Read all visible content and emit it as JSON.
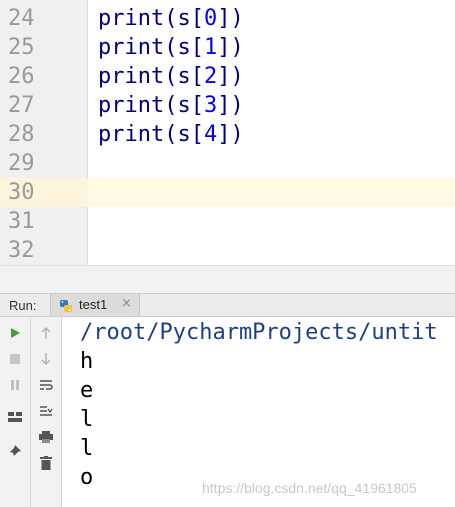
{
  "editor": {
    "lines": [
      {
        "num": "24",
        "pre": "print(s[",
        "idx": "0",
        "post": "])"
      },
      {
        "num": "25",
        "pre": "print(s[",
        "idx": "1",
        "post": "])"
      },
      {
        "num": "26",
        "pre": "print(s[",
        "idx": "2",
        "post": "])"
      },
      {
        "num": "27",
        "pre": "print(s[",
        "idx": "3",
        "post": "])"
      },
      {
        "num": "28",
        "pre": "print(s[",
        "idx": "4",
        "post": "])"
      },
      {
        "num": "29",
        "pre": "",
        "idx": "",
        "post": ""
      },
      {
        "num": "30",
        "pre": "",
        "idx": "",
        "post": ""
      },
      {
        "num": "31",
        "pre": "",
        "idx": "",
        "post": ""
      },
      {
        "num": "32",
        "pre": "",
        "idx": "",
        "post": ""
      }
    ],
    "current_line_index": 6
  },
  "run_panel": {
    "label": "Run:",
    "tab": {
      "label": "test1",
      "close": "×",
      "icon": "python-file-icon"
    },
    "console_lines": [
      "/root/PycharmProjects/untit",
      "h",
      "e",
      "l",
      "l",
      "o"
    ]
  },
  "watermark": "https://blog.csdn.net/qq_41961805",
  "colors": {
    "keyword": "#000080",
    "number": "#0000ff",
    "current_line": "#fffae3",
    "gutter": "#f0f0f0",
    "run_green": "#4a9b3c"
  }
}
